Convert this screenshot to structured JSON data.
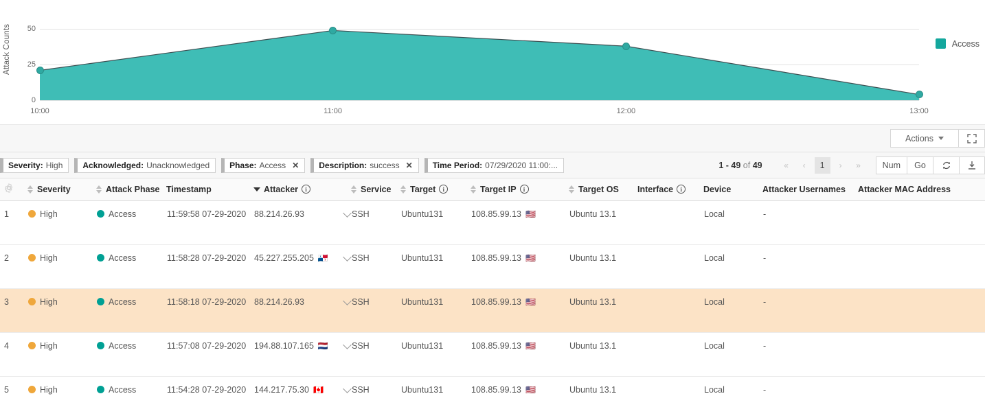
{
  "chart_data": {
    "type": "area",
    "title": "",
    "xlabel": "",
    "ylabel": "Attack Counts",
    "categories": [
      "10:00",
      "11:00",
      "12:00",
      "13:00"
    ],
    "series": [
      {
        "name": "Access",
        "values": [
          21,
          49,
          38,
          4
        ],
        "color": "#3fbdb6"
      }
    ],
    "yticks": [
      0,
      25,
      50
    ],
    "ylim": [
      0,
      55
    ],
    "grid": true,
    "legend_position": "right",
    "legend": [
      "Access"
    ]
  },
  "toolbar": {
    "actions_label": "Actions",
    "expand_icon": "expand-icon"
  },
  "filters": [
    {
      "key": "Severity:",
      "value": "High",
      "removable": false
    },
    {
      "key": "Acknowledged:",
      "value": "Unacknowledged",
      "removable": false
    },
    {
      "key": "Phase:",
      "value": "Access",
      "removable": true
    },
    {
      "key": "Description:",
      "value": "success",
      "removable": true
    },
    {
      "key": "Time Period:",
      "value": "07/29/2020 11:00:...",
      "removable": false
    }
  ],
  "pager": {
    "range": "1 - 49",
    "of": "of",
    "total": "49",
    "first": "«",
    "prev": "‹",
    "page": "1",
    "next": "›",
    "last": "»",
    "num_label": "Num",
    "go_label": "Go",
    "refresh_icon": "refresh-icon",
    "download_icon": "download-icon"
  },
  "table": {
    "settings_icon": "gear-icon",
    "columns": [
      {
        "label": "Severity",
        "sort": "both",
        "info": false
      },
      {
        "label": "Attack Phase",
        "sort": "both",
        "info": false
      },
      {
        "label": "Timestamp",
        "sort": "desc",
        "info": false
      },
      {
        "label": "Attacker",
        "sort": "none",
        "info": true
      },
      {
        "label": "Service",
        "sort": "both",
        "info": false
      },
      {
        "label": "Target",
        "sort": "both",
        "info": true
      },
      {
        "label": "Target IP",
        "sort": "both",
        "info": true
      },
      {
        "label": "Target OS",
        "sort": "both",
        "info": false
      },
      {
        "label": "Interface",
        "sort": "none",
        "info": true
      },
      {
        "label": "Device",
        "sort": "none",
        "info": false
      },
      {
        "label": "Attacker Usernames",
        "sort": "none",
        "info": false
      },
      {
        "label": "Attacker MAC Address",
        "sort": "none",
        "info": false
      }
    ],
    "rows": [
      {
        "index": "1",
        "severity": "High",
        "phase": "Access",
        "timestamp": "11:59:58 07-29-2020",
        "attacker": "88.214.26.93",
        "attacker_flag": "",
        "service": "SSH",
        "target": "Ubuntu131",
        "target_ip": "108.85.99.13",
        "target_ip_flag": "🇺🇸",
        "target_os": "Ubuntu 13.1",
        "interface": "",
        "device": "Local",
        "attacker_usernames": "-",
        "attacker_mac": "",
        "highlighted": false
      },
      {
        "index": "2",
        "severity": "High",
        "phase": "Access",
        "timestamp": "11:58:28 07-29-2020",
        "attacker": "45.227.255.205",
        "attacker_flag": "🇵🇦",
        "service": "SSH",
        "target": "Ubuntu131",
        "target_ip": "108.85.99.13",
        "target_ip_flag": "🇺🇸",
        "target_os": "Ubuntu 13.1",
        "interface": "",
        "device": "Local",
        "attacker_usernames": "-",
        "attacker_mac": "",
        "highlighted": false
      },
      {
        "index": "3",
        "severity": "High",
        "phase": "Access",
        "timestamp": "11:58:18 07-29-2020",
        "attacker": "88.214.26.93",
        "attacker_flag": "",
        "service": "SSH",
        "target": "Ubuntu131",
        "target_ip": "108.85.99.13",
        "target_ip_flag": "🇺🇸",
        "target_os": "Ubuntu 13.1",
        "interface": "",
        "device": "Local",
        "attacker_usernames": "-",
        "attacker_mac": "",
        "highlighted": true
      },
      {
        "index": "4",
        "severity": "High",
        "phase": "Access",
        "timestamp": "11:57:08 07-29-2020",
        "attacker": "194.88.107.165",
        "attacker_flag": "🇳🇱",
        "service": "SSH",
        "target": "Ubuntu131",
        "target_ip": "108.85.99.13",
        "target_ip_flag": "🇺🇸",
        "target_os": "Ubuntu 13.1",
        "interface": "",
        "device": "Local",
        "attacker_usernames": "-",
        "attacker_mac": "",
        "highlighted": false
      },
      {
        "index": "5",
        "severity": "High",
        "phase": "Access",
        "timestamp": "11:54:28 07-29-2020",
        "attacker": "144.217.75.30",
        "attacker_flag": "🇨🇦",
        "service": "SSH",
        "target": "Ubuntu131",
        "target_ip": "108.85.99.13",
        "target_ip_flag": "🇺🇸",
        "target_os": "Ubuntu 13.1",
        "interface": "",
        "device": "Local",
        "attacker_usernames": "-",
        "attacker_mac": "",
        "highlighted": false
      }
    ]
  },
  "colors": {
    "accent_teal": "#3fbdb6",
    "legend_teal": "#14a79d",
    "severity_high": "#efa73b",
    "phase_access": "#00a094",
    "row_highlight": "#fce3c6"
  }
}
